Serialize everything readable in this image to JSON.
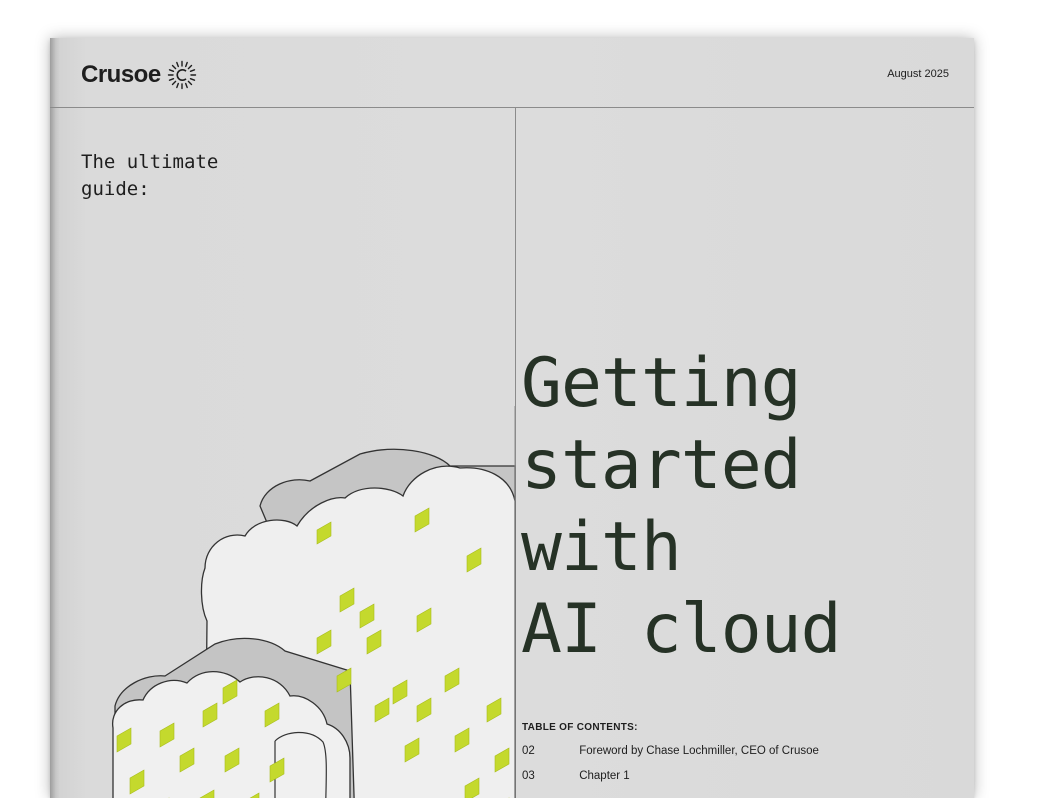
{
  "brand": {
    "name": "Crusoe",
    "logo_icon": "sunburst-c-logo-icon"
  },
  "header": {
    "date": "August 2025"
  },
  "cover": {
    "subtitle": "The ultimate\nguide:",
    "title_lines": [
      "Getting",
      "started",
      "with",
      "AI cloud"
    ],
    "accent_color": "#c4d92d",
    "title_color": "#263226"
  },
  "toc": {
    "heading": "TABLE OF CONTENTS:",
    "items": [
      {
        "page": "02",
        "label": "Foreword by Chase Lochmiller, CEO of Crusoe"
      },
      {
        "page": "03",
        "label": "Chapter 1"
      }
    ]
  },
  "illustration": {
    "icon": "isometric-cloud-illustration"
  }
}
